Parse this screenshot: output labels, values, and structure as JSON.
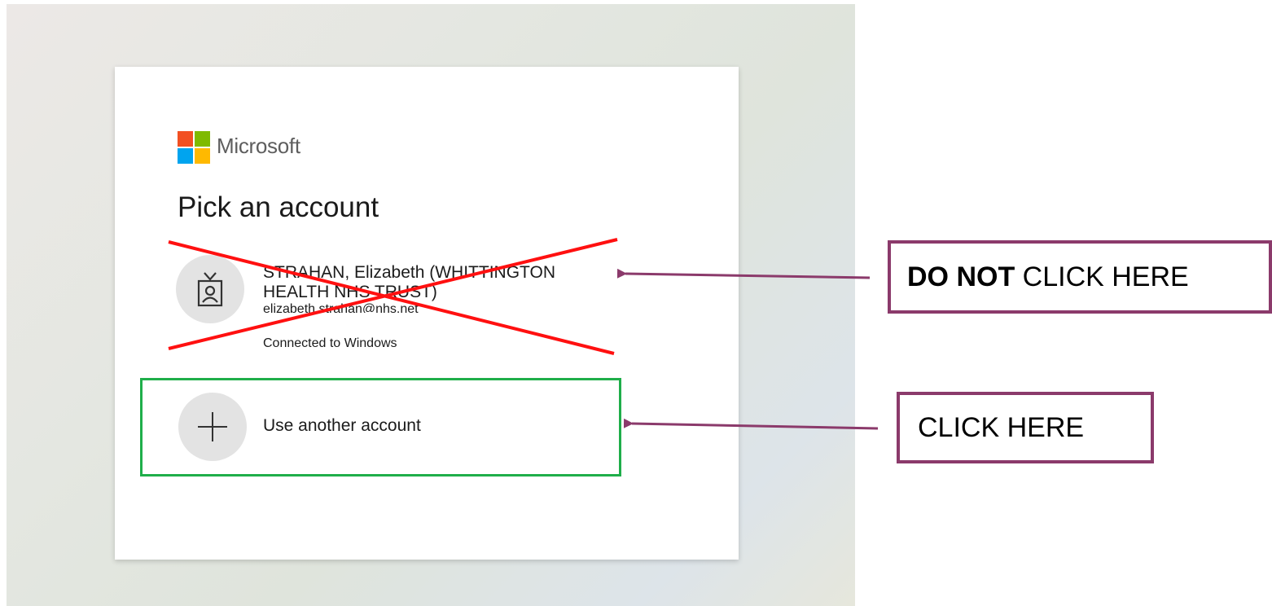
{
  "brand": {
    "name": "Microsoft",
    "logo_icon": "microsoft-logo-icon"
  },
  "dialog": {
    "heading": "Pick an account",
    "accounts": [
      {
        "name": "STRAHAN, Elizabeth (WHITTINGTON HEALTH NHS TRUST)",
        "email": "elizabeth.strahan@nhs.net",
        "status": "Connected to Windows",
        "icon": "badge-icon",
        "crossed_out": true
      }
    ],
    "use_another": {
      "label": "Use another account",
      "icon": "plus-icon"
    }
  },
  "annotations": {
    "do_not_click": {
      "bold": "DO NOT",
      "rest": " CLICK HERE"
    },
    "click_here": "CLICK HERE"
  },
  "colors": {
    "cross": "#ff1010",
    "highlight_box": "#1fae4a",
    "callout_border": "#8b3a6b",
    "arrow": "#8b3a6b"
  }
}
